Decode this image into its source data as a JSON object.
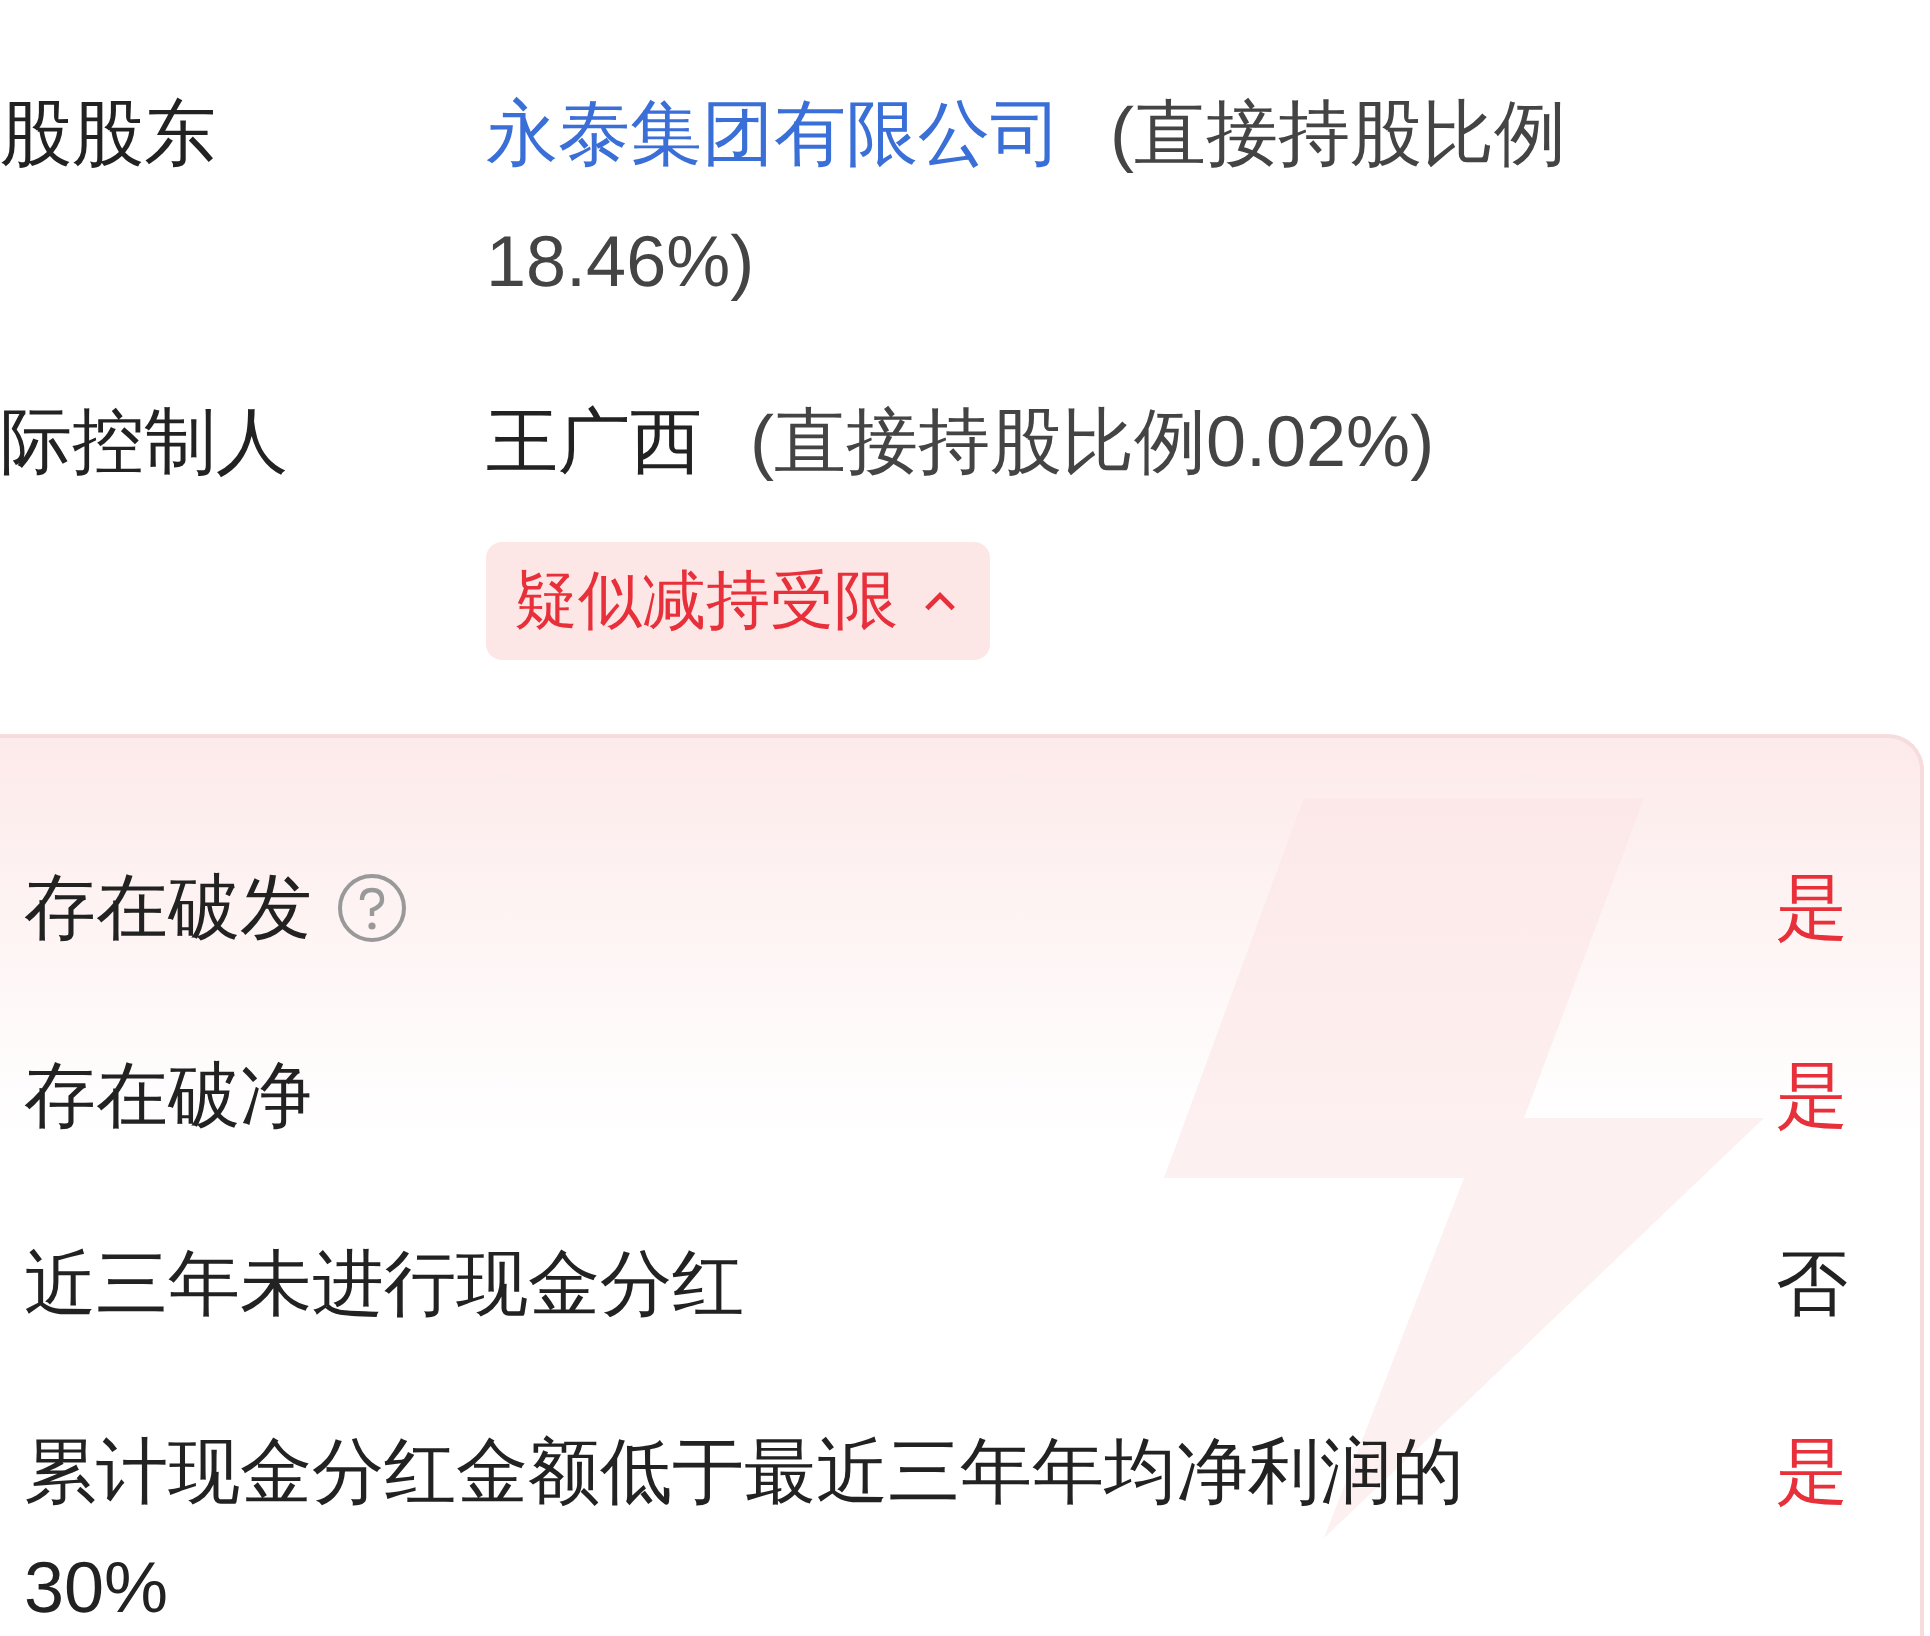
{
  "holders": [
    {
      "label": "股股东",
      "value": "永泰集团有限公司",
      "link": true,
      "note": "(直接持股比例18.46%)"
    },
    {
      "label": "际控制人",
      "value": "王广西",
      "link": false,
      "note": "(直接持股比例0.02%)"
    }
  ],
  "tag": {
    "label": "疑似减持受限",
    "expanded": true
  },
  "checks": [
    {
      "label": "存在破发",
      "help": true,
      "value": "是",
      "flagged": true
    },
    {
      "label": "存在破净",
      "help": false,
      "value": "是",
      "flagged": true
    },
    {
      "label": "近三年未进行现金分红",
      "help": false,
      "value": "否",
      "flagged": false
    },
    {
      "label": "累计现金分红金额低于最近三年年均净利润的30%",
      "help": false,
      "value": "是",
      "flagged": true
    }
  ]
}
